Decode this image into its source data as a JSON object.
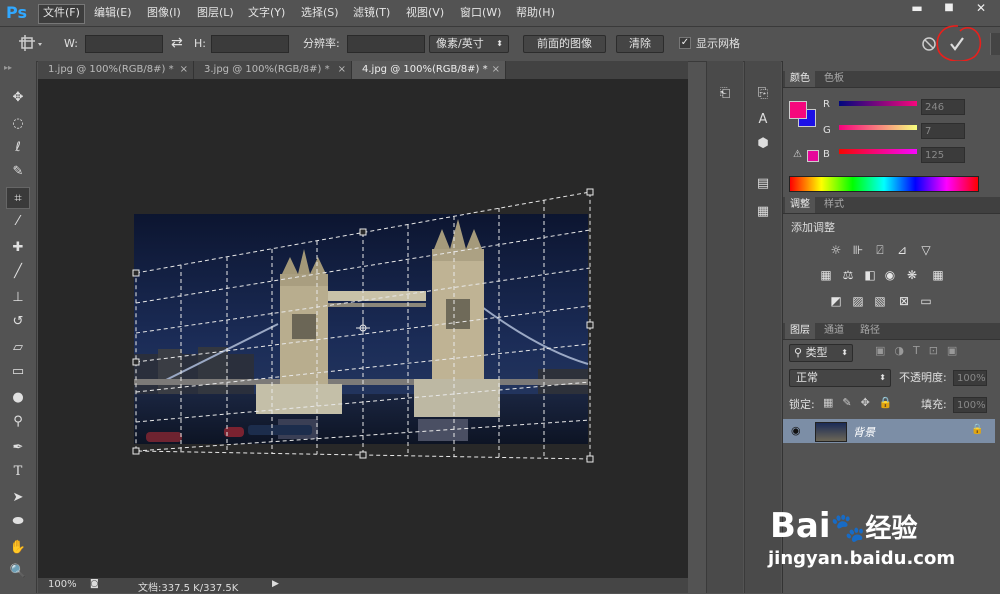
{
  "app": {
    "logo": "Ps"
  },
  "menu": [
    {
      "label": "文件(F)",
      "active": true
    },
    {
      "label": "编辑(E)"
    },
    {
      "label": "图像(I)"
    },
    {
      "label": "图层(L)"
    },
    {
      "label": "文字(Y)"
    },
    {
      "label": "选择(S)"
    },
    {
      "label": "滤镜(T)"
    },
    {
      "label": "视图(V)"
    },
    {
      "label": "窗口(W)"
    },
    {
      "label": "帮助(H)"
    }
  ],
  "window_controls": {
    "minimize": "▬",
    "maximize": "■",
    "close": "✕"
  },
  "options": {
    "w_label": "W:",
    "w_value": "",
    "h_label": "H:",
    "h_value": "",
    "resolution_label": "分辨率:",
    "resolution_value": "",
    "unit_select": "像素/英寸",
    "front_image_button": "前面的图像",
    "clear_button": "清除",
    "show_grid_label": "显示网格",
    "show_grid_checked": true
  },
  "tabs": [
    {
      "label": "1.jpg @ 100%(RGB/8#) *",
      "close": "×"
    },
    {
      "label": "3.jpg @ 100%(RGB/8#) *",
      "close": "×"
    },
    {
      "label": "4.jpg @ 100%(RGB/8#) *",
      "close": "×",
      "active": true
    }
  ],
  "status": {
    "zoom": "100%",
    "doc_info": "文档:337.5 K/337.5K"
  },
  "color_panel": {
    "tabs": [
      "颜色",
      "色板"
    ],
    "channels": [
      {
        "label": "R",
        "value": "246"
      },
      {
        "label": "G",
        "value": "7"
      },
      {
        "label": "B",
        "value": "125"
      }
    ],
    "foreground": "#f6077d",
    "background": "#1b10e6"
  },
  "adjust_panel": {
    "tabs": [
      "调整",
      "样式"
    ],
    "title": "添加调整"
  },
  "layers_panel": {
    "tabs": [
      "图层",
      "通道",
      "路径"
    ],
    "filter": "类型",
    "blend_mode": "正常",
    "opacity_label": "不透明度:",
    "opacity_value": "100%",
    "lock_label": "锁定:",
    "fill_label": "填充:",
    "fill_value": "100%",
    "layer_name": "背景"
  },
  "watermark": {
    "brand": "Bai",
    "brand2": "经验",
    "url": "jingyan.baidu.com"
  }
}
